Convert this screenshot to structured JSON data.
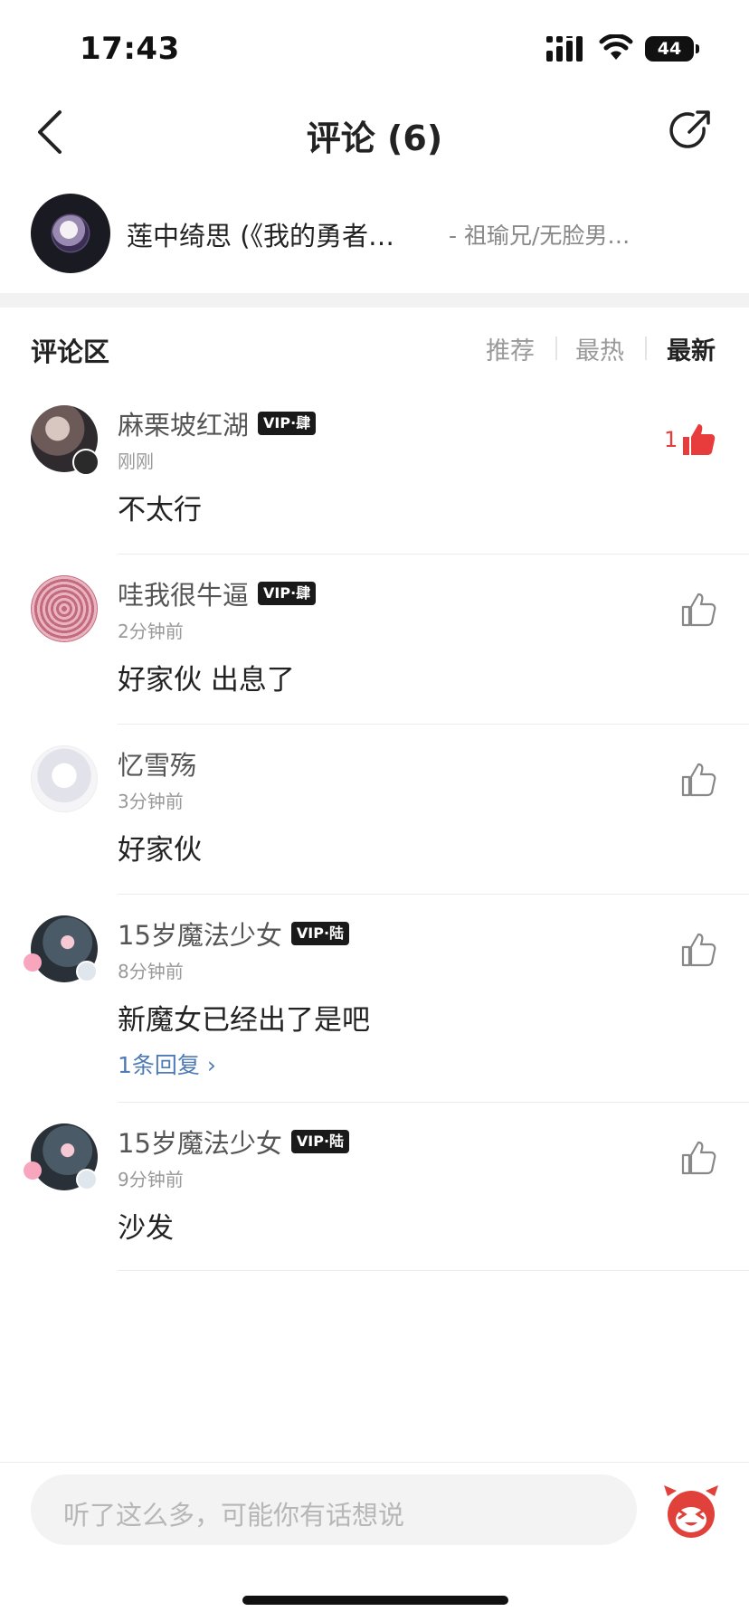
{
  "status": {
    "time": "17:43",
    "battery": "44"
  },
  "nav": {
    "title": "评论 (6)"
  },
  "song": {
    "title": "莲中绮思 (《我的勇者…",
    "artist": "- 祖瑜兄/无脸男…"
  },
  "section": {
    "label": "评论区",
    "sort_options": [
      "推荐",
      "最热",
      "最新"
    ],
    "active_sort": "最新"
  },
  "comments": [
    {
      "name": "麻栗坡红湖",
      "vip": "VIP·肆",
      "time": "刚刚",
      "text": "不太行",
      "likes": "1",
      "liked": true
    },
    {
      "name": "哇我很牛逼",
      "vip": "VIP·肆",
      "time": "2分钟前",
      "text": "好家伙 出息了",
      "liked": false
    },
    {
      "name": "忆雪殇",
      "time": "3分钟前",
      "text": "好家伙",
      "liked": false
    },
    {
      "name": "15岁魔法少女",
      "vip": "VIP·陆",
      "time": "8分钟前",
      "text": "新魔女已经出了是吧",
      "replies": "1条回复",
      "liked": false
    },
    {
      "name": "15岁魔法少女",
      "vip": "VIP·陆",
      "time": "9分钟前",
      "text": "沙发",
      "liked": false
    }
  ],
  "input": {
    "placeholder": "听了这么多，可能你有话想说"
  },
  "colors": {
    "like_active": "#e83c3c",
    "link": "#4e7bb5",
    "vip_bg": "#1a1a1a"
  },
  "icons": [
    "back-arrow-icon",
    "share-icon",
    "thumbs-up-icon",
    "emoji-icon"
  ]
}
